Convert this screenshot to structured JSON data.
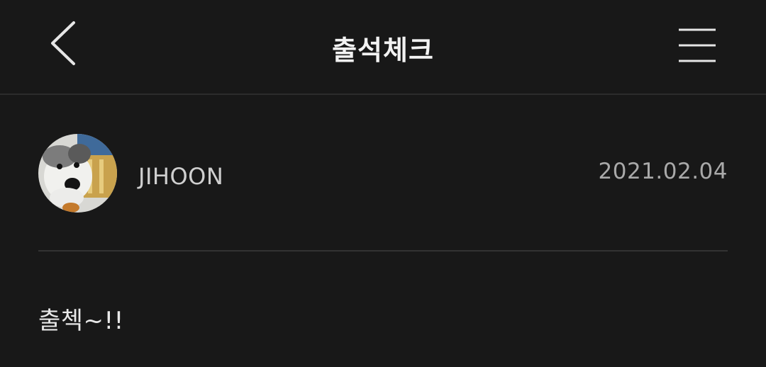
{
  "header": {
    "title": "출석체크",
    "back_icon": "chevron-left-icon",
    "menu_icon": "hamburger-menu-icon"
  },
  "post": {
    "author": "JIHOON",
    "date": "2021.02.04",
    "content": "출첵~!!"
  },
  "colors": {
    "background": "#181818",
    "title": "#f2f2f2",
    "author": "#cfcfcf",
    "date": "#a9a9a9",
    "divider": "#333333"
  }
}
